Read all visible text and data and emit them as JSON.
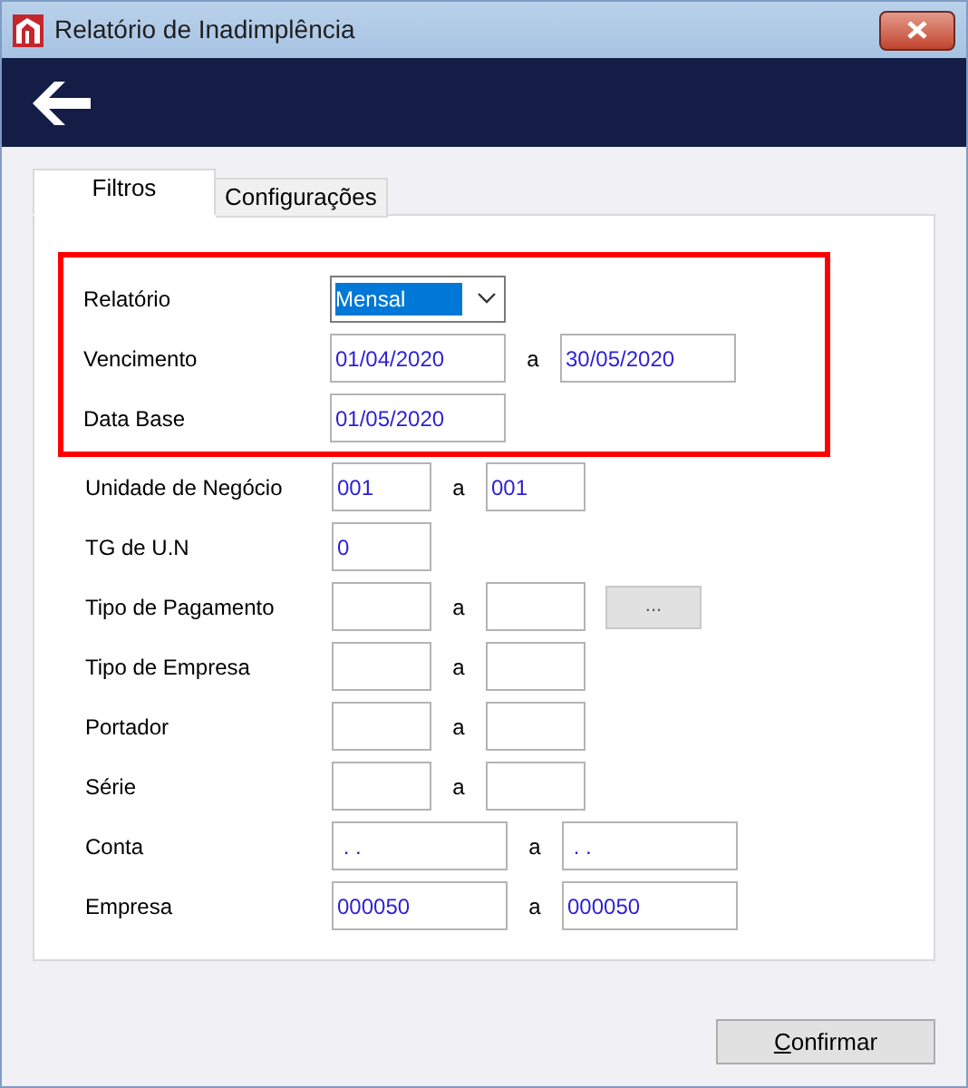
{
  "window": {
    "title": "Relatório de Inadimplência"
  },
  "tabs": [
    {
      "label": "Filtros",
      "selected": true
    },
    {
      "label": "Configurações",
      "selected": false
    }
  ],
  "highlighted_rows": [
    {
      "label": "Relatório",
      "kind": "select",
      "from": "Mensal",
      "text_selected": true
    },
    {
      "label": "Vencimento",
      "kind": "long_range",
      "separator": "a",
      "from": "01/04/2020",
      "to": "30/05/2020"
    },
    {
      "label": "Data Base",
      "kind": "long_single",
      "from": "01/05/2020"
    }
  ],
  "rows": [
    {
      "label": "Unidade de Negócio",
      "kind": "short_range",
      "separator": "a",
      "from": "001",
      "to": "001"
    },
    {
      "label": "TG de U.N",
      "kind": "short_single",
      "from": "0"
    },
    {
      "label": "Tipo de Pagamento",
      "kind": "short_range",
      "separator": "a",
      "lookup_button": "..."
    },
    {
      "label": "Tipo de Empresa",
      "kind": "short_range",
      "separator": "a"
    },
    {
      "label": "Portador",
      "kind": "short_range",
      "separator": "a"
    },
    {
      "label": "Série",
      "kind": "short_range",
      "separator": "a"
    },
    {
      "label": "Conta",
      "kind": "long_range",
      "separator": "a",
      "from": " . .",
      "to": " . ."
    },
    {
      "label": "Empresa",
      "kind": "long_range",
      "separator": "a",
      "from": "000050",
      "to": "000050"
    }
  ],
  "buttons": [
    {
      "label": "Confirmar"
    }
  ]
}
